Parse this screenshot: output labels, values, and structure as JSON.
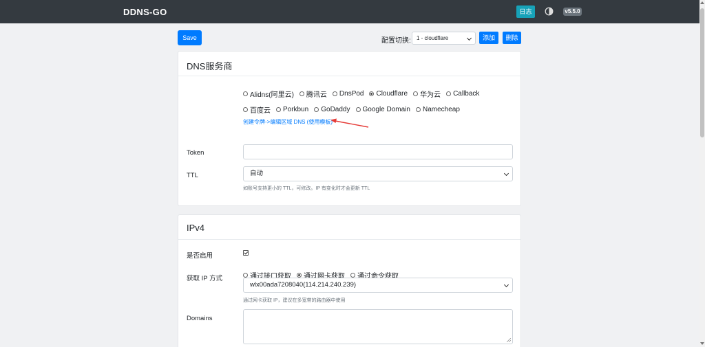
{
  "navbar": {
    "brand": "DDNS-GO",
    "log_label": "日志",
    "version": "v5.5.0"
  },
  "toolbar": {
    "save_label": "Save",
    "config_switch_label": "配置切换:",
    "config_selected": "1 - cloudflare",
    "add_label": "添加",
    "delete_label": "删除"
  },
  "dns": {
    "title": "DNS服务商",
    "providers_row1": [
      {
        "label": "Alidns(阿里云)",
        "selected": false
      },
      {
        "label": "腾讯云",
        "selected": false
      },
      {
        "label": "DnsPod",
        "selected": false
      },
      {
        "label": "Cloudflare",
        "selected": true
      },
      {
        "label": "华为云",
        "selected": false
      },
      {
        "label": "Callback",
        "selected": false
      }
    ],
    "providers_row2": [
      {
        "label": "百度云",
        "selected": false
      },
      {
        "label": "Porkbun",
        "selected": false
      },
      {
        "label": "GoDaddy",
        "selected": false
      },
      {
        "label": "Google Domain",
        "selected": false
      },
      {
        "label": "Namecheap",
        "selected": false
      }
    ],
    "token_link": "创建令牌->编辑区域 DNS (使用模板)",
    "token_label": "Token",
    "token_value": "",
    "ttl_label": "TTL",
    "ttl_value": "自动",
    "ttl_help": "如账号支持更小的 TTL，可修改。IP 有变化时才会更新 TTL"
  },
  "ipv4": {
    "title": "IPv4",
    "enable_label": "是否启用",
    "enabled": true,
    "method_label": "获取 IP 方式",
    "methods": [
      {
        "label": "通过接口获取",
        "selected": false
      },
      {
        "label": "通过网卡获取",
        "selected": true
      },
      {
        "label": "通过命令获取",
        "selected": false
      }
    ],
    "interface_value": "wlx00ada7208040(114.214.240.239)",
    "interface_help": "通过网卡获取 IP，建议在多宽带的路由器中使用",
    "domains_label": "Domains",
    "domains_value": ""
  },
  "colors": {
    "navbar": "#343a40",
    "primary": "#007bff",
    "info": "#17a2b8",
    "badge": "#6c757d",
    "annotation_arrow": "#e53935"
  }
}
